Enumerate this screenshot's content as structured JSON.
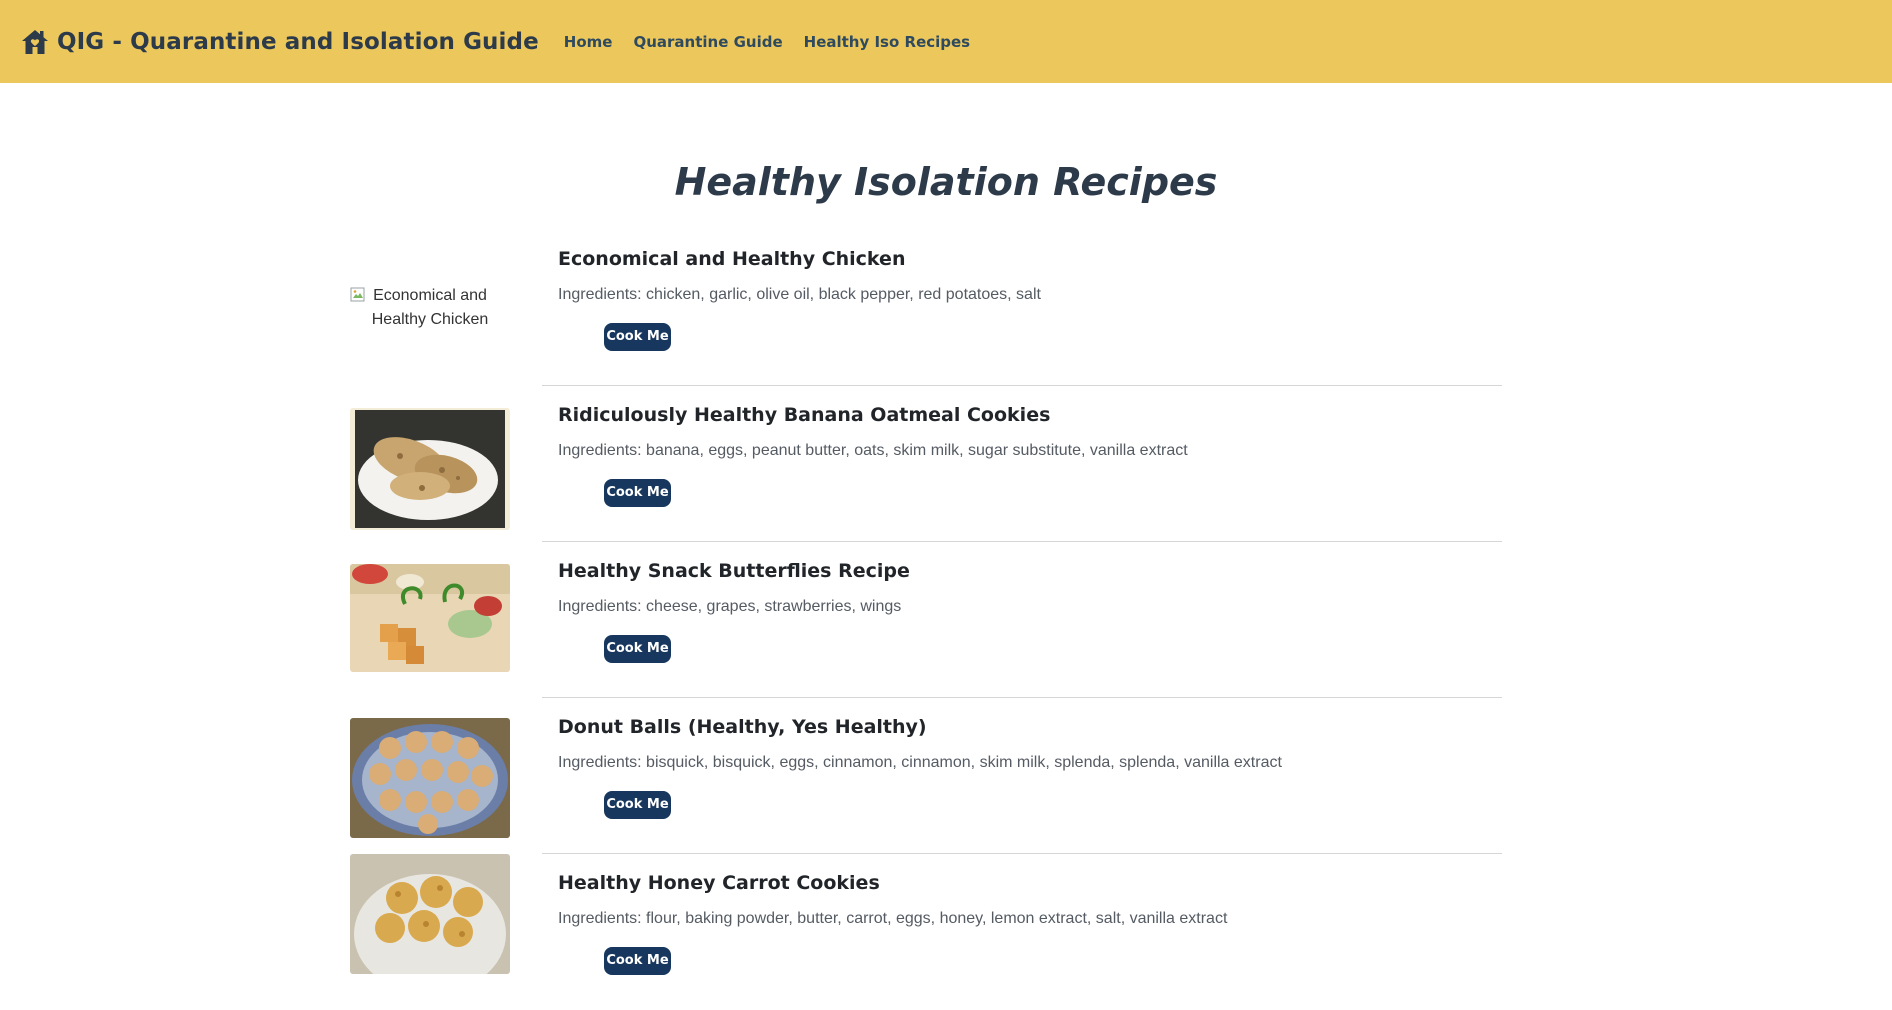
{
  "navbar": {
    "brand": "QIG - Quarantine and Isolation Guide",
    "brand_icon": "home-icon",
    "links": [
      {
        "label": "Home"
      },
      {
        "label": "Quarantine Guide"
      },
      {
        "label": "Healthy Iso Recipes"
      }
    ],
    "bg_color": "#ecc85c"
  },
  "page_title": "Healthy Isolation Recipes",
  "recipes": [
    {
      "title": "Economical and Healthy Chicken",
      "ingredients": "Ingredients: chicken, garlic, olive oil, black pepper, red potatoes, salt",
      "image_alt": "Economical and Healthy Chicken",
      "button": "Cook Me"
    },
    {
      "title": "Ridiculously Healthy Banana Oatmeal Cookies",
      "ingredients": "Ingredients: banana, eggs, peanut butter, oats, skim milk, sugar substitute, vanilla extract",
      "button": "Cook Me"
    },
    {
      "title": "Healthy Snack Butterflies Recipe",
      "ingredients": "Ingredients: cheese, grapes, strawberries, wings",
      "button": "Cook Me"
    },
    {
      "title": "Donut Balls (Healthy, Yes Healthy)",
      "ingredients": "Ingredients: bisquick, bisquick, eggs, cinnamon, cinnamon, skim milk, splenda, splenda, vanilla extract",
      "button": "Cook Me"
    },
    {
      "title": "Healthy Honey Carrot Cookies",
      "ingredients": "Ingredients: flour, baking powder, butter, carrot, eggs, honey, lemon extract, salt, vanilla extract",
      "button": "Cook Me"
    }
  ],
  "button_color": "#17375e"
}
